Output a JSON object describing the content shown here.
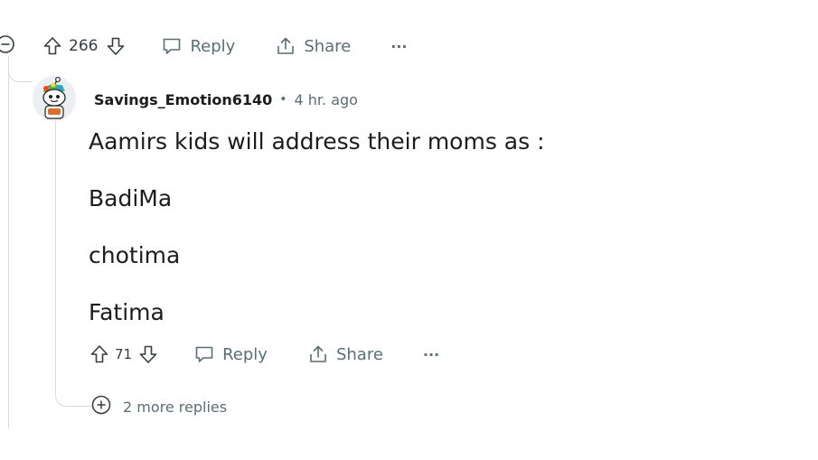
{
  "parent_actions": {
    "score": "266",
    "reply_label": "Reply",
    "share_label": "Share",
    "more_label": "···"
  },
  "comment": {
    "author": "Savings_Emotion6140",
    "separator": "•",
    "time": "4 hr. ago",
    "body": [
      "Aamirs kids will address their moms as :",
      "BadiMa",
      "chotima",
      "Fatima"
    ],
    "actions": {
      "score": "71",
      "reply_label": "Reply",
      "share_label": "Share",
      "more_label": "···"
    },
    "more_replies": "2 more replies"
  },
  "colors": {
    "meta_text": "#576f76",
    "body_text": "#1c1c1c",
    "thread_line": "#d8dadc"
  },
  "icons": {
    "collapse": "collapse-minus-icon",
    "upvote": "upvote-arrow-icon",
    "downvote": "downvote-arrow-icon",
    "reply": "speech-bubble-icon",
    "share": "share-upload-icon",
    "more": "ellipsis-icon",
    "expand": "expand-plus-icon"
  }
}
